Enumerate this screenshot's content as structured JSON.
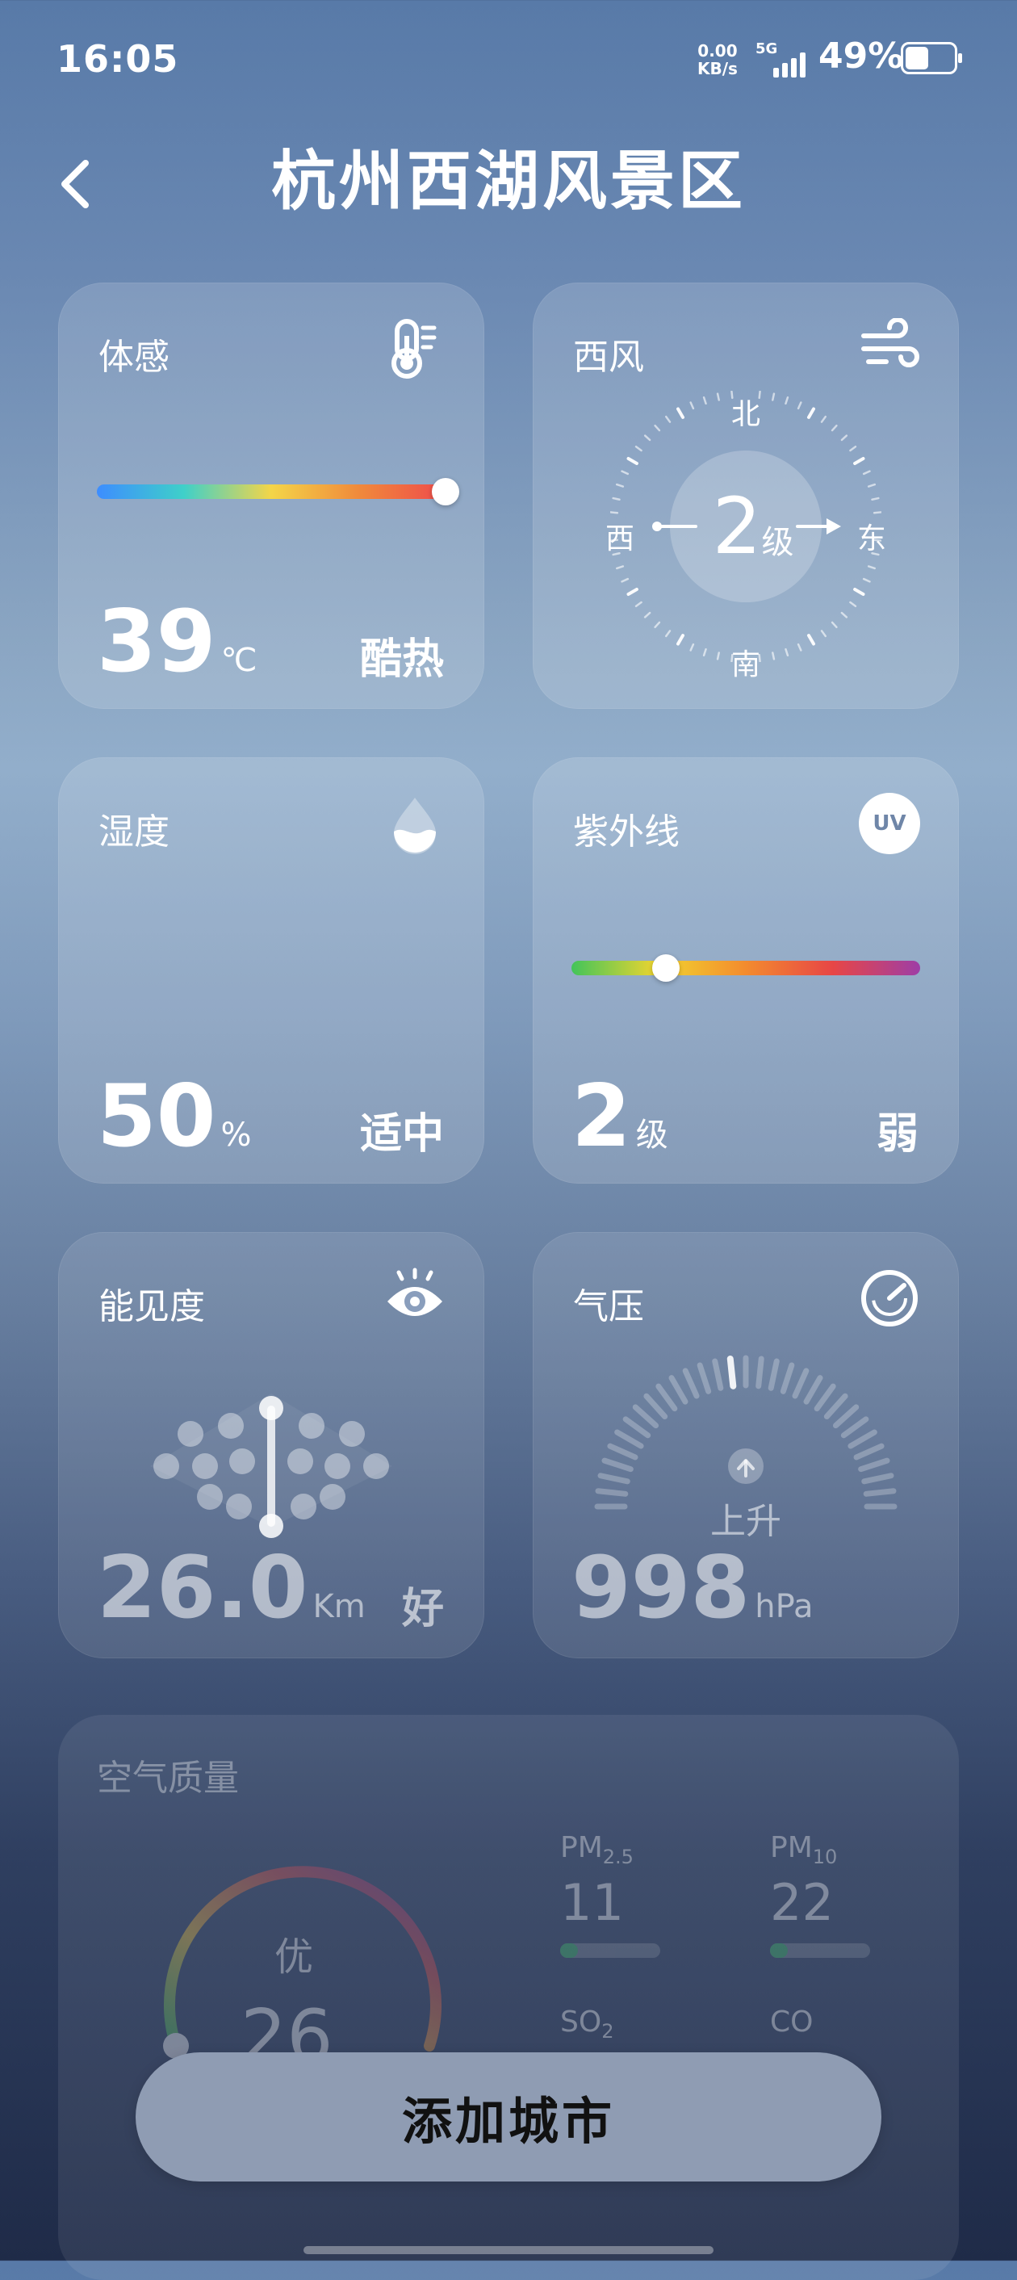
{
  "status_bar": {
    "time": "16:05",
    "net_speed_value": "0.00",
    "net_speed_unit": "KB/s",
    "signal_label": "5G",
    "battery_percent": "49%",
    "battery_level": 0.49
  },
  "header": {
    "title": "杭州西湖风景区"
  },
  "feels_like": {
    "label": "体感",
    "value": "39",
    "unit": "℃",
    "desc": "酷热",
    "icon": "thermometer-icon",
    "level": 1.0
  },
  "wind": {
    "label": "西风",
    "level_value": "2",
    "level_unit": "级",
    "north": "北",
    "south": "南",
    "west": "西",
    "east": "东",
    "icon": "wind-icon"
  },
  "humidity": {
    "label": "湿度",
    "value": "50",
    "unit": "%",
    "desc": "适中",
    "icon": "water-drop-icon"
  },
  "uv": {
    "label": "紫外线",
    "value": "2",
    "unit": "级",
    "desc": "弱",
    "icon": "uv-icon",
    "icon_text": "UV",
    "level": 0.27
  },
  "visibility": {
    "label": "能见度",
    "value": "26.0",
    "unit": "Km",
    "desc": "好",
    "icon": "eye-icon"
  },
  "pressure": {
    "label": "气压",
    "value": "998",
    "unit": "hPa",
    "trend": "上升",
    "icon": "gauge-icon"
  },
  "air_quality": {
    "label": "空气质量",
    "level_text": "优",
    "aqi": "26",
    "items": [
      {
        "name": "PM",
        "sub": "2.5",
        "value": "11"
      },
      {
        "name": "PM",
        "sub": "10",
        "value": "22"
      },
      {
        "name": "SO",
        "sub": "2",
        "value": ""
      },
      {
        "name": "CO",
        "sub": "",
        "value": ""
      }
    ]
  },
  "add_city_button": "添加城市"
}
